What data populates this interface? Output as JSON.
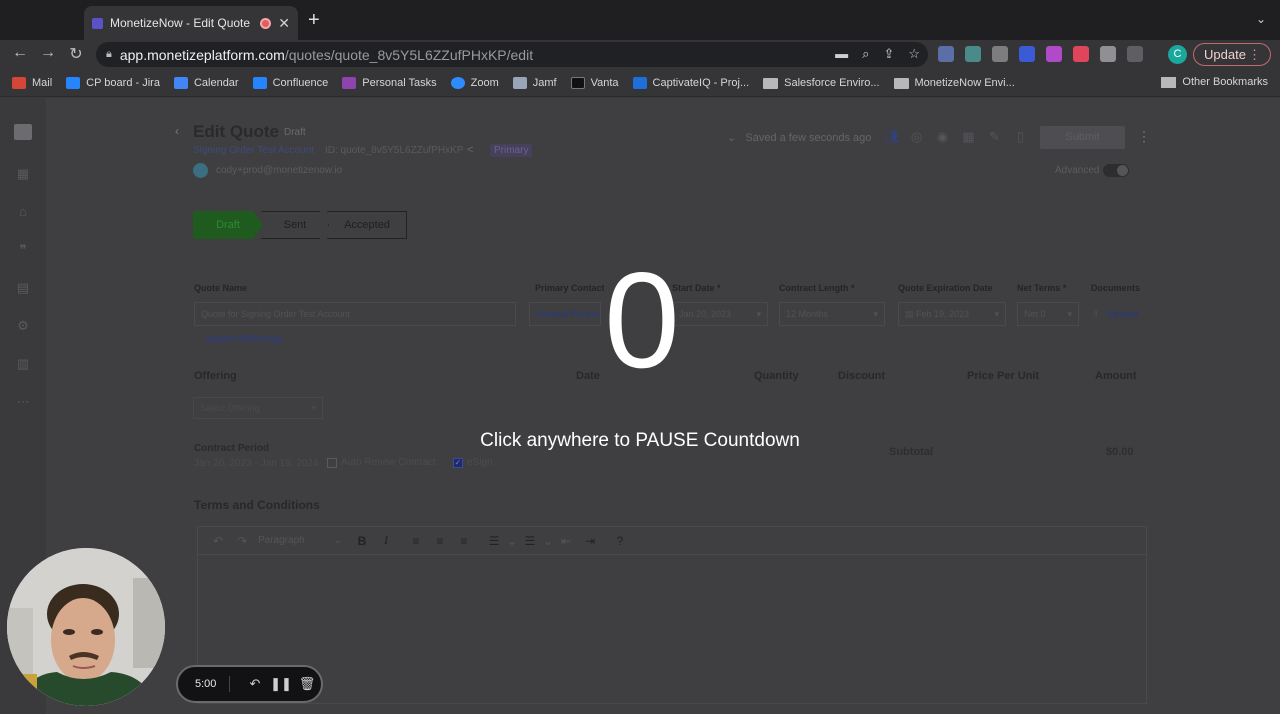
{
  "browser": {
    "tab_title": "MonetizeNow - Edit Quote",
    "new_tab": "+",
    "url_host": "app.monetizeplatform.com",
    "url_path": "/quotes/quote_8v5Y5L6ZZufPHxKP/edit",
    "profile_initial": "C",
    "update_label": "Update",
    "bookmarks": [
      {
        "label": "Mail",
        "color": "#d44638"
      },
      {
        "label": "CP board - Jira",
        "color": "#2684ff"
      },
      {
        "label": "Calendar",
        "color": "#4285f4"
      },
      {
        "label": "Confluence",
        "color": "#2684ff"
      },
      {
        "label": "Personal Tasks",
        "color": "#8e44ad"
      },
      {
        "label": "Zoom",
        "color": "#2d8cff"
      },
      {
        "label": "Jamf",
        "color": "#9aa6b8"
      },
      {
        "label": "Vanta",
        "color": "#111111"
      },
      {
        "label": "CaptivateIQ - Proj...",
        "color": "#1e6fd9"
      }
    ],
    "folder_bookmarks": [
      "Salesforce Enviro...",
      "MonetizeNow Envi..."
    ],
    "other_bookmarks": "Other Bookmarks"
  },
  "quote": {
    "title": "Edit Quote",
    "status_chip": "Draft",
    "account": "Signing Order Test Account",
    "id_text": "ID: quote_8v5Y5L6ZZufPHxKP",
    "primary_badge": "Primary",
    "owner_email": "cody+prod@monetizenow.io",
    "saved_text": "Saved a few seconds ago",
    "submit_label": "Submit",
    "advanced_label": "Advanced",
    "steps": [
      "Draft",
      "Sent",
      "Accepted"
    ],
    "fields": {
      "quote_name_label": "Quote Name",
      "quote_name_value": "Quote for Signing Order Test Account",
      "primary_contact_label": "Primary Contact",
      "primary_contact_value": "Internal Person",
      "start_date_label": "Start Date *",
      "start_date_value": "Jan 20, 2023",
      "contract_length_label": "Contract Length *",
      "contract_length_value": "12 Months",
      "expiration_label": "Quote Expiration Date",
      "expiration_value": "Feb 19, 2023",
      "net_terms_label": "Net Terms *",
      "net_terms_value": "Net 0",
      "documents_label": "Documents",
      "upload_label": "Upload"
    },
    "import_offerings": "Import Offerings",
    "columns": [
      "Offering",
      "Date",
      "Quantity",
      "Discount",
      "Price Per Unit",
      "Amount"
    ],
    "offering_placeholder": "Select Offering",
    "contract_period_label": "Contract Period",
    "contract_period_value": "Jan 20, 2023 - Jan 19, 2024",
    "auto_renew_label": "Auto Renew Contract",
    "esign_label": "eSign",
    "subtotal_label": "Subtotal",
    "subtotal_value": "$0.00",
    "terms_title": "Terms and Conditions",
    "editor_block_type": "Paragraph"
  },
  "countdown": {
    "number": "0",
    "hint": "Click anywhere to PAUSE Countdown"
  },
  "recorder": {
    "time": "5:00"
  }
}
